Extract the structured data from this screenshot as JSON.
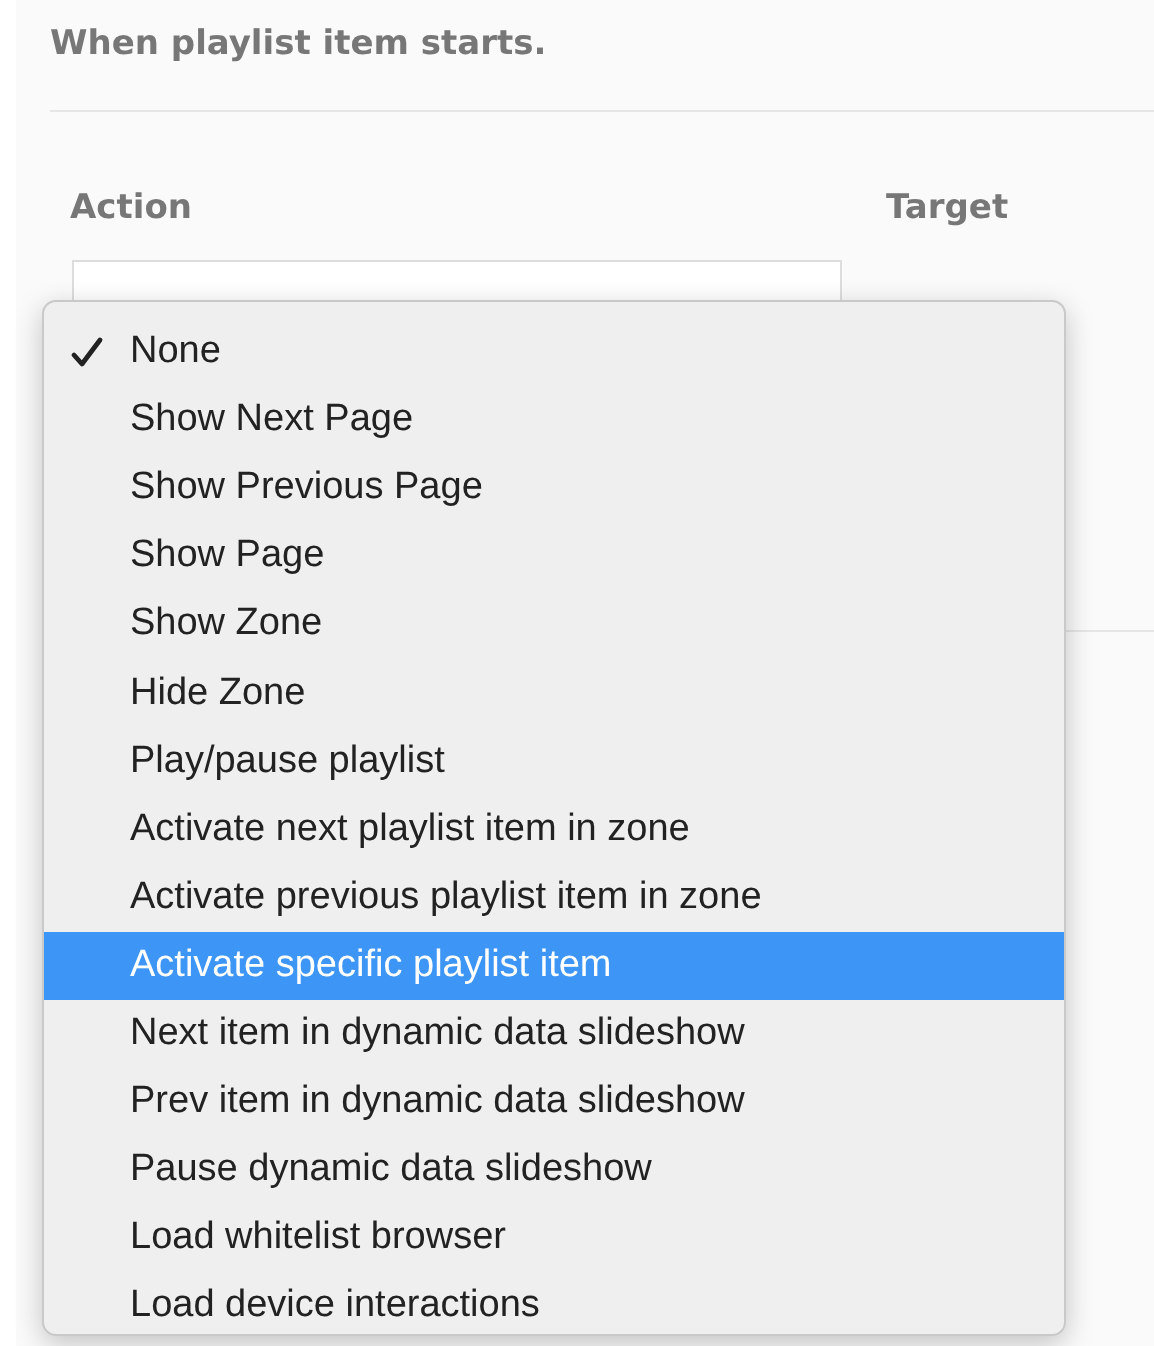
{
  "section": {
    "title": "When playlist item starts."
  },
  "columns": [
    {
      "label": "Action"
    },
    {
      "label": "Target"
    }
  ],
  "action_menu": {
    "items": [
      {
        "label": "None",
        "checked": true,
        "selected": false
      },
      {
        "label": "Show Next Page",
        "checked": false,
        "selected": false
      },
      {
        "label": "Show Previous Page",
        "checked": false,
        "selected": false
      },
      {
        "label": "Show Page",
        "checked": false,
        "selected": false
      },
      {
        "label": "Show Zone",
        "checked": false,
        "selected": false
      },
      {
        "label": "Hide Zone",
        "checked": false,
        "selected": false
      },
      {
        "label": "Play/pause playlist",
        "checked": false,
        "selected": false
      },
      {
        "label": "Activate next playlist item in zone",
        "checked": false,
        "selected": false
      },
      {
        "label": "Activate previous playlist item in zone",
        "checked": false,
        "selected": false
      },
      {
        "label": "Activate specific playlist item",
        "checked": false,
        "selected": true
      },
      {
        "label": "Next item in dynamic data slideshow",
        "checked": false,
        "selected": false
      },
      {
        "label": "Prev item in dynamic data slideshow",
        "checked": false,
        "selected": false
      },
      {
        "label": "Pause dynamic data slideshow",
        "checked": false,
        "selected": false
      },
      {
        "label": "Load whitelist browser",
        "checked": false,
        "selected": false
      },
      {
        "label": "Load device interactions",
        "checked": false,
        "selected": false
      }
    ]
  }
}
